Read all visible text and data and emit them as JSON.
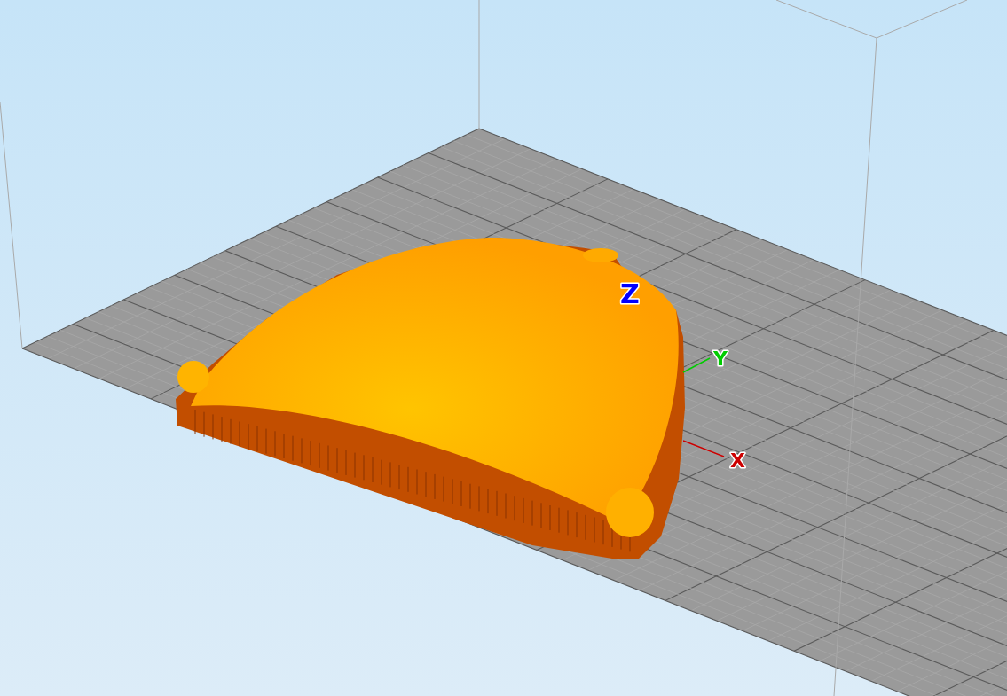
{
  "viewport": {
    "axes": [
      {
        "label": "Z",
        "color": "#0000ff"
      },
      {
        "label": "Y",
        "color": "#00cc00"
      },
      {
        "label": "X",
        "color": "#cc0000"
      }
    ]
  }
}
